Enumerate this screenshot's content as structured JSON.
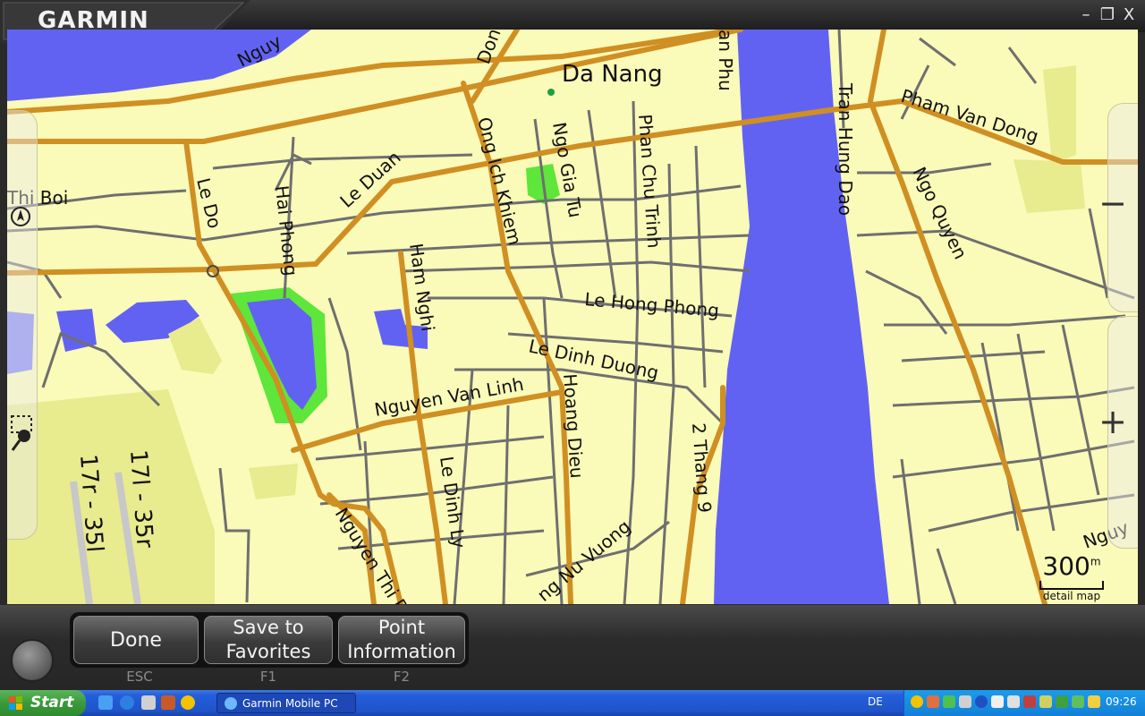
{
  "app": {
    "logo": "GARMIN",
    "window_controls": {
      "minimize": "–",
      "restore": "❐",
      "close": "X"
    }
  },
  "map": {
    "city_label": "Da Nang",
    "street_labels": [
      "Nguy",
      "Don",
      "an Phu",
      "Pham Van Dong",
      "Tran Hung Dao",
      "Ngo Quyen",
      "Ngo Gia Tu",
      "Phan Chu Trinh",
      "Ong Ich Khiem",
      "Le Duan",
      "Thi Boi",
      "Le Do",
      "Hai Phong",
      "Ham Nghi",
      "Le Hong Phong",
      "Le Dinh Duong",
      "Nguyen Van Linh",
      "Hoang Dieu",
      "2 Thang 9",
      "Le Dinh Ly",
      "Nguyen Thi Ph",
      "ng Nu Vuong",
      "Nguy",
      "17l - 35r",
      "17r - 35l"
    ],
    "scale": {
      "value": "300",
      "unit": "m",
      "caption": "detail map"
    },
    "zoom_in": "+",
    "zoom_out": "−",
    "colors": {
      "land": "#fafab9",
      "water": "#6262f2",
      "park": "#5ee63a",
      "main_road": "#cf8f22",
      "road": "#6f6f6f"
    }
  },
  "toolbar": {
    "buttons": [
      {
        "label": "Done",
        "key": "ESC"
      },
      {
        "label": "Save to Favorites",
        "key": "F1"
      },
      {
        "label": "Point Information",
        "key": "F2"
      }
    ]
  },
  "taskbar": {
    "start_label": "Start",
    "active_task": "Garmin Mobile PC",
    "language": "DE",
    "clock": "09:26"
  }
}
